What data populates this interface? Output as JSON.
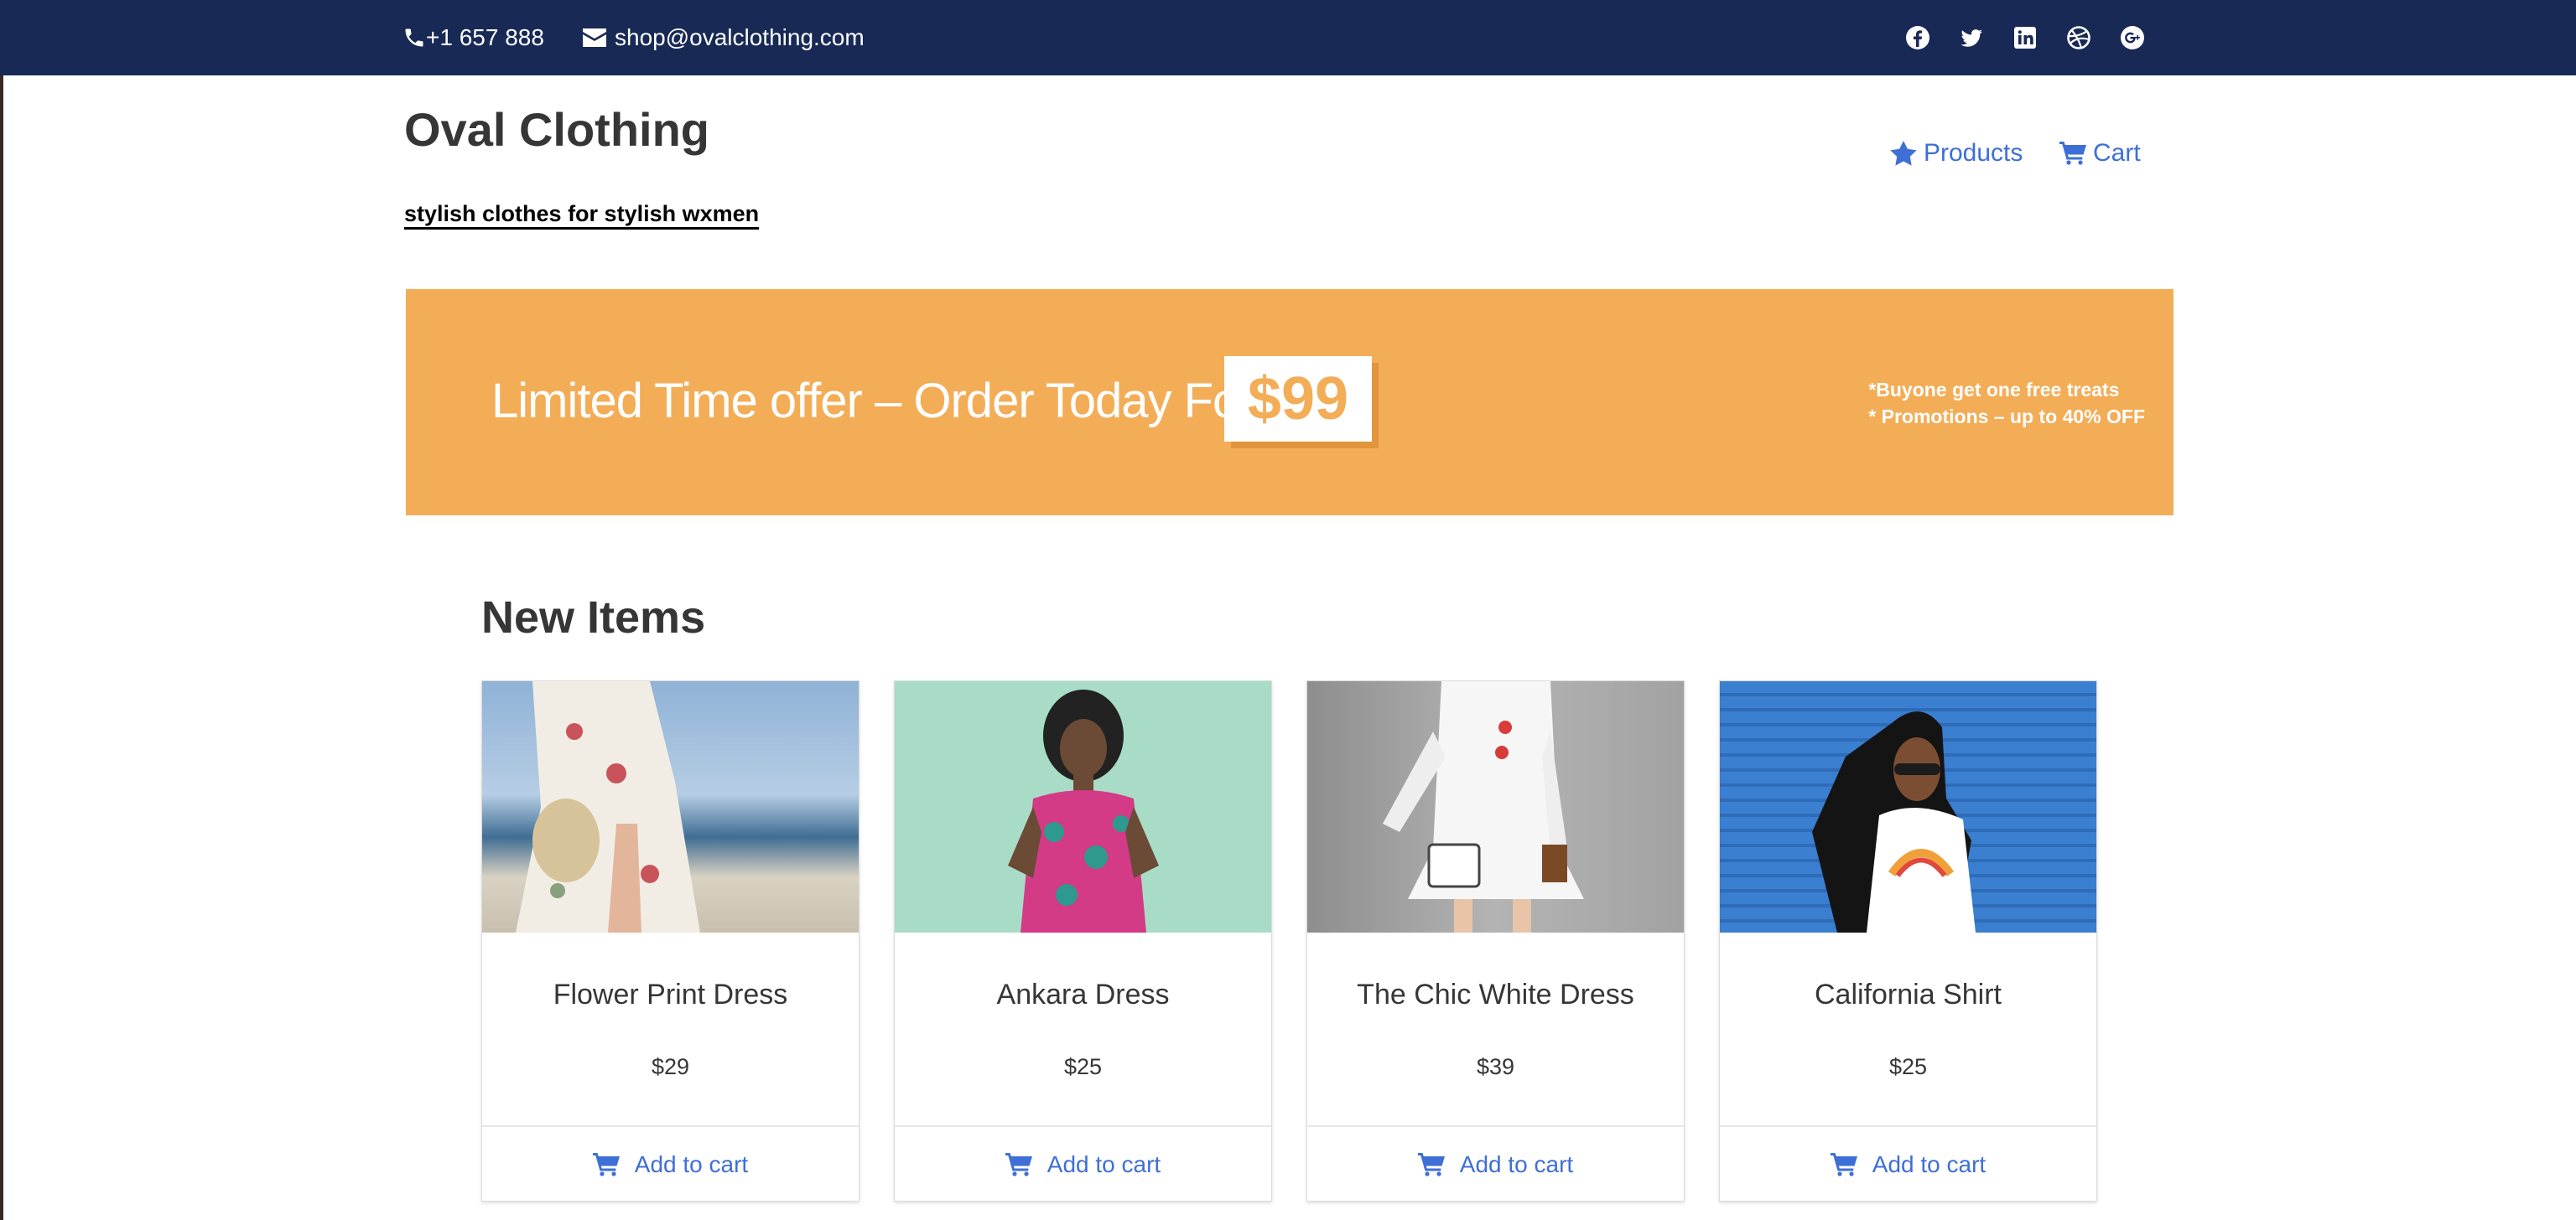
{
  "topbar": {
    "phone": "+1 657 888",
    "email": "shop@ovalclothing.com",
    "social_icons": [
      "facebook-icon",
      "twitter-icon",
      "linkedin-icon",
      "dribbble-icon",
      "google-plus-icon"
    ]
  },
  "header": {
    "title": "Oval Clothing",
    "tagline": "stylish clothes for stylish wxmen",
    "nav": [
      {
        "label": "Products",
        "icon": "star-icon"
      },
      {
        "label": "Cart",
        "icon": "cart-icon"
      }
    ]
  },
  "banner": {
    "text": "Limited Time offer – Order Today For",
    "price": "$99",
    "promo_line1": "*Buyone get one free treats",
    "promo_line2": "* Promotions – up to 40% OFF"
  },
  "section": {
    "title": "New Items"
  },
  "products": [
    {
      "name": "Flower Print Dress",
      "price": "$29",
      "action": "Add to cart"
    },
    {
      "name": "Ankara Dress",
      "price": "$25",
      "action": "Add to cart"
    },
    {
      "name": "The Chic White Dress",
      "price": "$39",
      "action": "Add to cart"
    },
    {
      "name": "California Shirt",
      "price": "$25",
      "action": "Add to cart"
    }
  ],
  "colors": {
    "topbar": "#182955",
    "accent": "#3e6fd6",
    "banner": "#f3ad57"
  }
}
